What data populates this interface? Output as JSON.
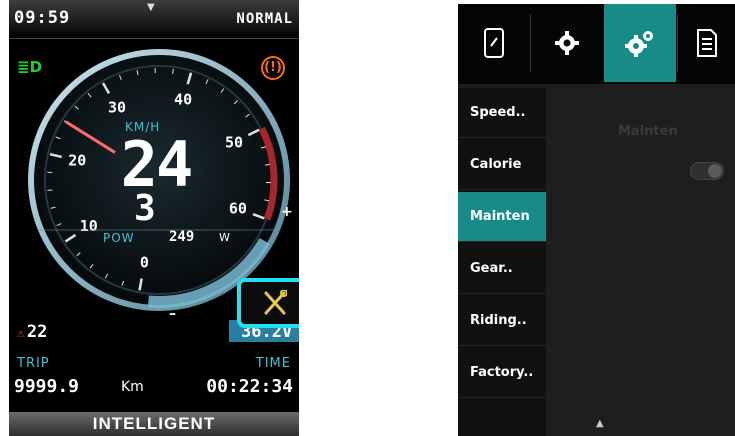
{
  "left_display": {
    "status": {
      "time": "09:59",
      "mode": "NORMAL",
      "pull_icon": "pull-down-arrow-icon"
    },
    "indicators": {
      "headlight_icon": "headlight-icon",
      "warning_icon": "warning-icon",
      "warning_symbol": "(!)"
    },
    "gauge": {
      "ticks": [
        "0",
        "10",
        "20",
        "30",
        "40",
        "50",
        "60"
      ],
      "unit": "KM/H",
      "speed": "24",
      "speed_value": 24,
      "speed_max": 60,
      "gear": "3",
      "plus": "+",
      "minus": "–"
    },
    "power": {
      "label": "POW",
      "value": "249",
      "unit": "W"
    },
    "error": {
      "code": "22"
    },
    "voltage": {
      "value": "36.2V"
    },
    "maintenance_button": {
      "icon": "wrench-screwdriver-icon"
    },
    "trip": {
      "label": "TRIP",
      "value": "9999.9",
      "unit": "Km"
    },
    "time": {
      "label": "TIME",
      "value": "00:22:34"
    },
    "assist_mode": "INTELLIGENT",
    "colors": {
      "accent": "#3cc3d6",
      "headlight": "#1fd12b",
      "warning": "#ff6a1a",
      "highlight": "#22e1ee"
    }
  },
  "right_display": {
    "tabs": [
      {
        "icon": "phone-icon"
      },
      {
        "icon": "gear-icon"
      },
      {
        "icon": "gears-icon"
      },
      {
        "icon": "document-icon"
      }
    ],
    "active_tab": 2,
    "menu": [
      "Speed..",
      "Calorie",
      "Mainten",
      "Gear..",
      "Riding..",
      "Factory.."
    ],
    "active_menu": 2,
    "content": {
      "title": "Mainten",
      "toggle_on": false
    },
    "bottom_arrow": "▲",
    "colors": {
      "accent": "#178b88"
    }
  }
}
